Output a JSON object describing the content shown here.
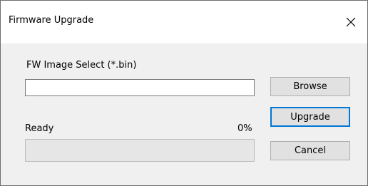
{
  "window": {
    "title": "Firmware Upgrade",
    "close_icon": "close-icon"
  },
  "form": {
    "fw_label": "FW Image Select (*.bin)",
    "file_path_value": "",
    "browse_label": "Browse",
    "upgrade_label": "Upgrade",
    "cancel_label": "Cancel"
  },
  "progress": {
    "status_text": "Ready",
    "percent_text": "0%",
    "value": 0,
    "fill_color": "#06b025"
  },
  "colors": {
    "focus_border": "#0078d7",
    "button_face": "#e1e1e1",
    "dialog_bg": "#f0f0f0"
  }
}
